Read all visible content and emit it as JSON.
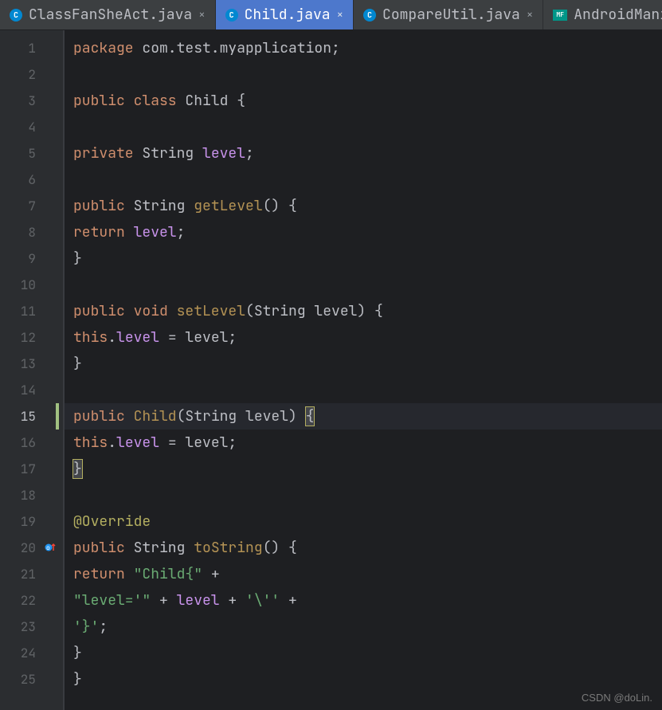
{
  "tabs": [
    {
      "label": "ClassFanSheAct.java",
      "icon": "c"
    },
    {
      "label": "Child.java",
      "icon": "c",
      "active": true
    },
    {
      "label": "CompareUtil.java",
      "icon": "c"
    },
    {
      "label": "AndroidManifest.x",
      "icon": "mf"
    }
  ],
  "gutter": {
    "lines": 25,
    "current": 15,
    "folds": [
      7,
      9,
      11,
      13,
      15,
      17,
      20,
      24
    ],
    "override_line": 20
  },
  "code": {
    "l1": {
      "kw1": "package",
      "pkg": " com.test.myapplication",
      "s": ";"
    },
    "l3": {
      "kw1": "public",
      "kw2": " class",
      "name": " Child",
      "br": " {"
    },
    "l5": {
      "kw1": "private",
      "type": " String",
      "field": " level",
      "s": ";"
    },
    "l7": {
      "kw1": "public",
      "type": " String",
      "method": " getLevel",
      "par": "()",
      "br": " {"
    },
    "l8": {
      "kw1": "return",
      "field": " level",
      "s": ";"
    },
    "l9": {
      "br": "}"
    },
    "l11": {
      "kw1": "public",
      "kw2": " void",
      "method": " setLevel",
      "par": "(String level)",
      "br": " {"
    },
    "l12": {
      "this": "this",
      "dot": ".",
      "field": "level",
      "eq": " = level",
      "s": ";"
    },
    "l13": {
      "br": "}"
    },
    "l15": {
      "kw1": "public",
      "ctor": " Child",
      "par": "(String level)",
      "sp": " ",
      "br": "{"
    },
    "l16": {
      "this": "this",
      "dot": ".",
      "field": "level",
      "eq": " = level",
      "s": ";"
    },
    "l17": {
      "br": "}"
    },
    "l19": {
      "anno": "@Override"
    },
    "l20": {
      "kw1": "public",
      "type": " String",
      "method": " toString",
      "par": "()",
      "br": " {"
    },
    "l21": {
      "kw1": "return",
      "sp": " ",
      "str": "\"Child{\"",
      "plus": " +"
    },
    "l22": {
      "str1": "\"level='\"",
      "plus1": " + ",
      "field": "level",
      "plus2": " + ",
      "str2": "'\\''",
      "plus3": " +"
    },
    "l23": {
      "str": "'}'",
      "s": ";"
    },
    "l24": {
      "br": "}"
    },
    "l25": {
      "br": "}"
    }
  },
  "watermark": "CSDN @doLin.",
  "colors": {
    "keyword": "#cf8e6d",
    "string": "#6aab73",
    "field": "#c792ea",
    "annotation": "#b3ae60",
    "background": "#1e1f22",
    "active_tab": "#4d78cc"
  }
}
